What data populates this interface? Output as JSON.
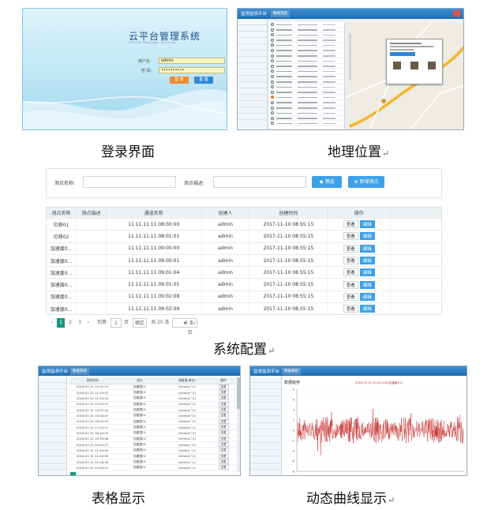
{
  "captions": {
    "login": "登录界面",
    "location": "地理位置",
    "config": "系统配置",
    "table": "表格显示",
    "curve": "动态曲线显示"
  },
  "login": {
    "title": "云平台管理系统",
    "subtitle": "Cloud Manage System",
    "user_label": "用户名：",
    "user_value": "admin",
    "pass_label": "密 码：",
    "pass_value": "••••••••••",
    "login_btn": "登 录",
    "reset_btn": "重 置",
    "colors": {
      "login": "#f08a2c",
      "reset": "#2f86d6"
    }
  },
  "app": {
    "title": "监测监测平台",
    "tab": "数据系统"
  },
  "config": {
    "point_name_label": "测点名称:",
    "point_desc_label": "测点描述:",
    "filter_btn": "筛选",
    "add_btn": "新增测点",
    "columns": [
      "测点名称",
      "测点描述",
      "通道名称",
      "创建人",
      "创建时间",
      "操作"
    ],
    "rows": [
      [
        "位移01",
        "",
        "11.11.11.11.08:00:00",
        "admin",
        "2017-11-10 08:55:15"
      ],
      [
        "位移02",
        "",
        "11.11.11.11.08:01:01",
        "admin",
        "2017-11-10 08:55:15"
      ],
      [
        "加速度0...",
        "",
        "11.11.11.11.09:00:00",
        "admin",
        "2017-11-10 08:55:15"
      ],
      [
        "加速度0...",
        "",
        "11.11.11.11.09:00:01",
        "admin",
        "2017-11-10 08:55:15"
      ],
      [
        "加速度0...",
        "",
        "11.11.11.11.09:01:04",
        "admin",
        "2017-11-10 08:55:15"
      ],
      [
        "加速度0...",
        "",
        "11.11.11.11.09:01:05",
        "admin",
        "2017-11-10 08:55:15"
      ],
      [
        "加速度0...",
        "",
        "11.11.11.11.09:02:08",
        "admin",
        "2017-11-10 08:55:15"
      ],
      [
        "加速度0...",
        "",
        "11.11.11.11.09:02:09",
        "admin",
        "2017-11-10 08:55:15"
      ]
    ],
    "view_btn": "查看",
    "edit_btn": "编辑",
    "pager": {
      "pages": [
        "1",
        "2",
        "3"
      ],
      "goto": "到第",
      "page_input": "1",
      "page_unit": "页",
      "confirm": "确定",
      "total": "共 20 条",
      "per_page": "8 条/页"
    }
  },
  "grid": {
    "columns": [
      "采样时间",
      "测点",
      "测量值(单位)",
      "操作"
    ],
    "rows": [
      [
        "2016-07-31 10:31:15",
        "加速度01",
        "0(mm/s^2)",
        "查看"
      ],
      [
        "2016-07-31 11:15:47",
        "加速度01",
        "0(mm/s^2)",
        "查看"
      ],
      [
        "2016-07-31 12:15:00",
        "加速度01",
        "0(mm/s^2)",
        "查看"
      ],
      [
        "2016-07-31 13:25:57",
        "加速度01",
        "0(mm/s^2)",
        "查看"
      ],
      [
        "2016-07-31 14:37:22",
        "加速度01",
        "0(mm/s^2)",
        "查看"
      ],
      [
        "2016-07-31 15:28:07",
        "加速度01",
        "0(mm/s^2)",
        "查看"
      ],
      [
        "2016-07-31 16:40:42",
        "加速度01",
        "0(mm/s^2)",
        "查看"
      ],
      [
        "2016-07-31 17:12:17",
        "加速度01",
        "0(mm/s^2)",
        "查看"
      ],
      [
        "2016-07-31 18:42:03",
        "加速度01",
        "0(mm/s^2)",
        "查看"
      ],
      [
        "2016-07-31 19:39:08",
        "加速度01",
        "0(mm/s^2)",
        "查看"
      ],
      [
        "2016-07-31 20:42:27",
        "加速度01",
        "0(mm/s^2)",
        "查看"
      ],
      [
        "2016-07-31 21:43:29",
        "加速度01",
        "0(mm/s^2)",
        "查看"
      ],
      [
        "2016-07-31 21:42:59",
        "加速度01",
        "0(mm/s^2)",
        "查看"
      ],
      [
        "2016-07-31 22:16:46",
        "加速度01",
        "0(mm/s^2)",
        "查看"
      ],
      [
        "2016-07-31 23:20:12",
        "加速度01",
        "0(mm/s^2)",
        "查看"
      ]
    ]
  },
  "curve": {
    "title": "数据趋势",
    "legend": "2016-07-31 20:04:0.00(加速度01)",
    "yticks": [
      "8",
      "6",
      "4",
      "2",
      "0",
      "-2",
      "-4",
      "-6",
      "-8"
    ],
    "series_color": "#c62828"
  }
}
